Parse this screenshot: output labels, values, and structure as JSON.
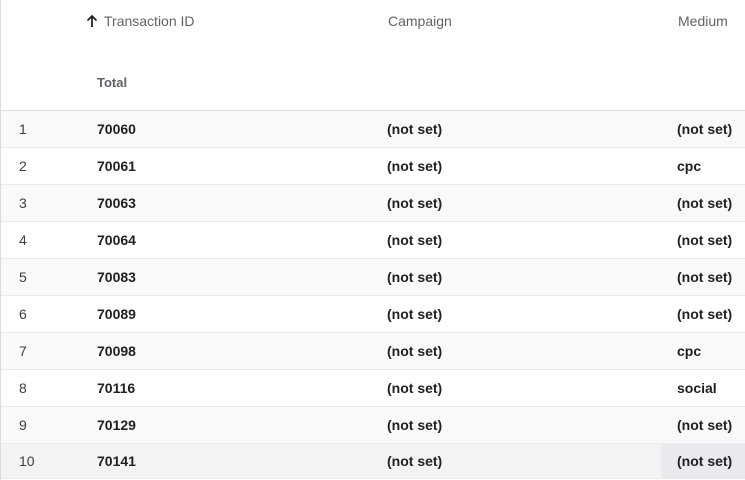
{
  "header": {
    "columns": {
      "transaction_id": "Transaction ID",
      "campaign": "Campaign",
      "medium": "Medium"
    },
    "sort_icon": "arrow-up-icon",
    "total_label": "Total"
  },
  "rows": [
    {
      "index": "1",
      "transaction_id": "70060",
      "campaign": "(not set)",
      "medium": "(not set)"
    },
    {
      "index": "2",
      "transaction_id": "70061",
      "campaign": "(not set)",
      "medium": "cpc"
    },
    {
      "index": "3",
      "transaction_id": "70063",
      "campaign": "(not set)",
      "medium": "(not set)"
    },
    {
      "index": "4",
      "transaction_id": "70064",
      "campaign": "(not set)",
      "medium": "(not set)"
    },
    {
      "index": "5",
      "transaction_id": "70083",
      "campaign": "(not set)",
      "medium": "(not set)"
    },
    {
      "index": "6",
      "transaction_id": "70089",
      "campaign": "(not set)",
      "medium": "(not set)"
    },
    {
      "index": "7",
      "transaction_id": "70098",
      "campaign": "(not set)",
      "medium": "cpc"
    },
    {
      "index": "8",
      "transaction_id": "70116",
      "campaign": "(not set)",
      "medium": "social"
    },
    {
      "index": "9",
      "transaction_id": "70129",
      "campaign": "(not set)",
      "medium": "(not set)"
    },
    {
      "index": "10",
      "transaction_id": "70141",
      "campaign": "(not set)",
      "medium": "(not set)"
    }
  ],
  "colors": {
    "header_text": "#5f6368",
    "cell_text": "#202124",
    "row_alt": "#f8f9fa",
    "row_hover": "#f1f3f4",
    "border": "#dadce0"
  }
}
